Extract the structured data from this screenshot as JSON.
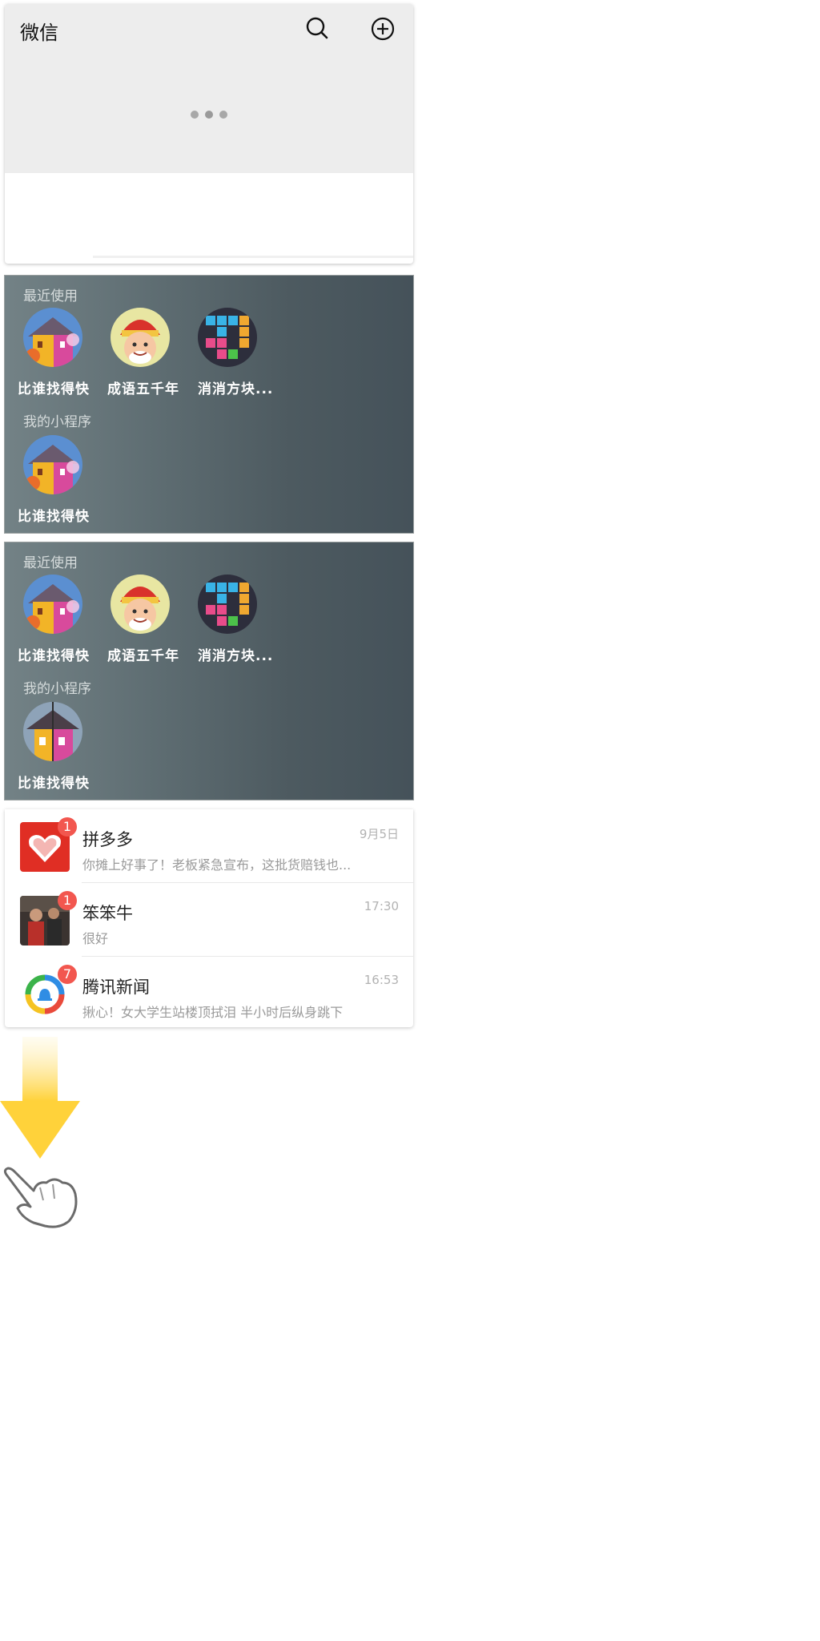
{
  "header": {
    "title": "微信",
    "search_icon": "search-icon",
    "add_icon": "plus-circle-icon",
    "loading_icon": "three-dots-loading"
  },
  "mini_panels": [
    {
      "recent_label": "最近使用",
      "recent_apps": [
        {
          "name": "比谁找得快",
          "icon": "house-game-icon"
        },
        {
          "name": "成语五千年",
          "icon": "old-man-game-icon"
        },
        {
          "name": "消消方块...",
          "icon": "block-puzzle-icon"
        }
      ],
      "mine_label": "我的小程序",
      "my_apps": [
        {
          "name": "比谁找得快",
          "icon": "house-game-icon"
        }
      ]
    },
    {
      "recent_label": "最近使用",
      "recent_apps": [
        {
          "name": "比谁找得快",
          "icon": "house-game-icon"
        },
        {
          "name": "成语五千年",
          "icon": "old-man-game-icon"
        },
        {
          "name": "消消方块...",
          "icon": "block-puzzle-icon"
        }
      ],
      "mine_label": "我的小程序",
      "my_apps": [
        {
          "name": "比谁找得快",
          "icon": "house-game-icon"
        }
      ]
    }
  ],
  "chats": [
    {
      "name": "拼多多",
      "message": "你摊上好事了！老板紧急宣布，这批货赔钱也...",
      "time": "9月5日",
      "badge": "1",
      "avatar": "pinduoduo-logo"
    },
    {
      "name": "笨笨牛",
      "message": "很好",
      "time": "17:30",
      "badge": "1",
      "avatar": "user-photo"
    },
    {
      "name": "腾讯新闻",
      "message": "揪心！女大学生站楼顶拭泪 半小时后纵身跳下",
      "time": "16:53",
      "badge": "7",
      "avatar": "tencent-news-logo"
    }
  ],
  "gesture": {
    "arrow": "arrow-down-icon",
    "hand": "pointing-hand-icon"
  },
  "colors": {
    "badge": "#f2574f",
    "header_bg": "#ededed",
    "panel_bg": "#5a686e",
    "arrow": "#ffd23a"
  }
}
